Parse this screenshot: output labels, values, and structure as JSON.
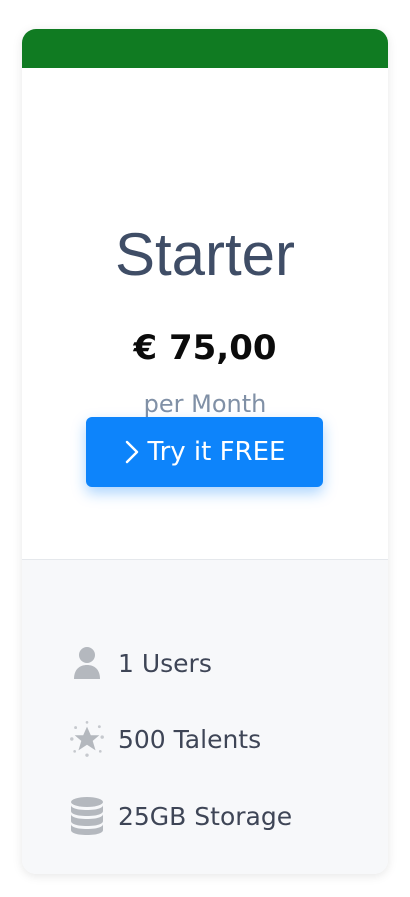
{
  "plan": {
    "name": "Starter",
    "price": "€ 75,00",
    "period": "per Month",
    "cta_label": "Try it FREE",
    "accent_color": "#107b22",
    "button_color": "#0d84fb"
  },
  "features": [
    {
      "icon": "user-icon",
      "label": "1 Users"
    },
    {
      "icon": "star-burst-icon",
      "label": "500 Talents"
    },
    {
      "icon": "database-icon",
      "label": "25GB Storage"
    }
  ]
}
